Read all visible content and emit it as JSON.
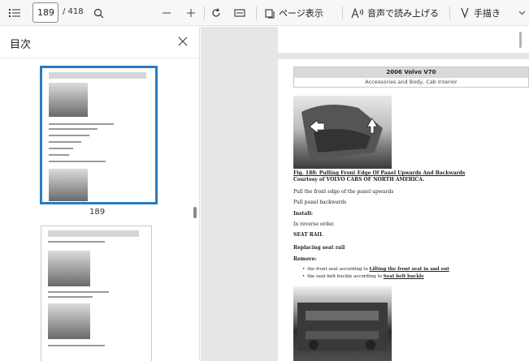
{
  "toolbar": {
    "page_number": "189",
    "page_total": "/ 418",
    "page_view_label": "ページ表示",
    "read_aloud_label": "音声で読み上げる",
    "draw_label": "手描き"
  },
  "sidebar": {
    "title": "目次",
    "thumbnail_page_number": "189"
  },
  "document": {
    "header_title": "2006 Volvo V70",
    "header_subtitle": "Accessories and Body, Cab Interior",
    "figure_caption_prefix": "Fig. 188: Pulling Front Edge Of Panel Upwards And Backwards",
    "figure_caption_courtesy": "Courtesy of VOLVO CARS OF NORTH AMERICA.",
    "step_1": "Pull the front edge of the panel upwards",
    "step_2": "Pull panel backwards",
    "install_heading": "Install:",
    "install_text": "In reverse order.",
    "seat_rail_heading": "SEAT RAIL",
    "replacing_heading": "Replacing seat rail",
    "remove_heading": "Remove:",
    "bullet_1_text": "the front seat according to",
    "bullet_1_link": "Lifting the front seat in and out",
    "bullet_2_text": "the seat belt buckle according to",
    "bullet_2_link": "Seat belt buckle"
  }
}
